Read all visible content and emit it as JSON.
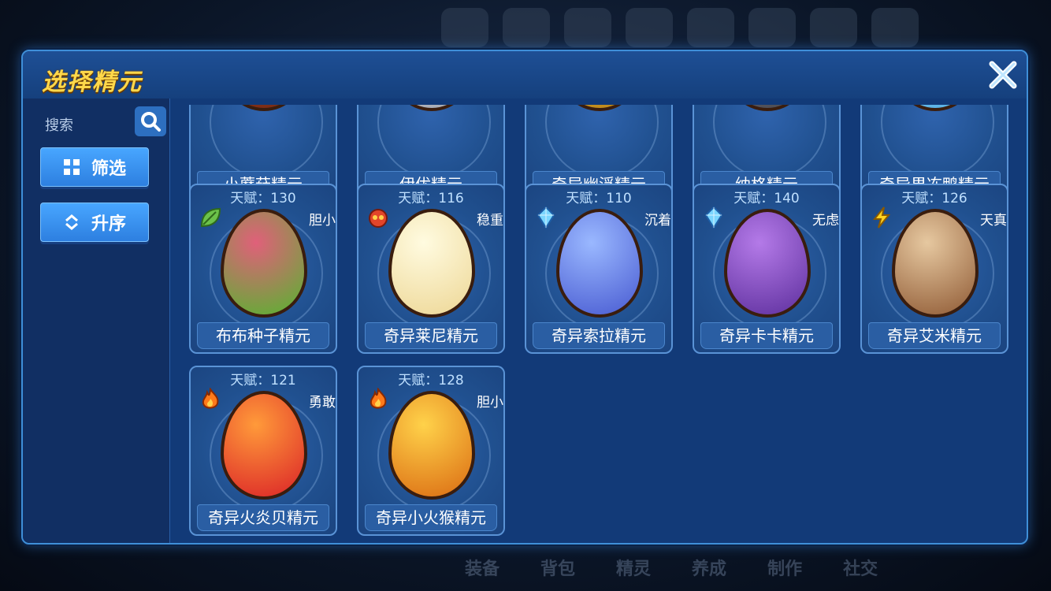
{
  "modal": {
    "title": "选择精元"
  },
  "sidebar": {
    "search_label": "搜索",
    "filter_label": "筛选",
    "sort_label": "升序"
  },
  "background": {
    "bottom_nav": [
      "装备",
      "背包",
      "精灵",
      "养成",
      "制作",
      "社交"
    ]
  },
  "cards": [
    {
      "name": "小蘑菇精元",
      "partial": true,
      "color_a": "#c2532a",
      "color_b": "#7a2c16"
    },
    {
      "name": "伊优精元",
      "partial": true,
      "color_a": "#e8eaee",
      "color_b": "#a8acb6"
    },
    {
      "name": "奇异幽浮精元",
      "partial": true,
      "color_a": "#f2c44a",
      "color_b": "#c08a1c"
    },
    {
      "name": "纳格精元",
      "partial": true,
      "color_a": "#8a8a90",
      "color_b": "#4e4e56"
    },
    {
      "name": "奇异果冻鸭精元",
      "partial": true,
      "color_a": "#a8e4ff",
      "color_b": "#5bb2e6"
    },
    {
      "name": "布布种子精元",
      "talent": "天赋：130",
      "nature": "胆小",
      "type_icon": "leaf-icon",
      "color_a": "#e0607a",
      "color_b": "#6aa83a"
    },
    {
      "name": "奇异莱尼精元",
      "talent": "天赋：116",
      "nature": "稳重",
      "type_icon": "fire-spirit-icon",
      "color_a": "#fffbe0",
      "color_b": "#f0dca0"
    },
    {
      "name": "奇异索拉精元",
      "talent": "天赋：110",
      "nature": "沉着",
      "type_icon": "crystal-icon",
      "color_a": "#9ab8ff",
      "color_b": "#5468d8"
    },
    {
      "name": "奇异卡卡精元",
      "talent": "天赋：140",
      "nature": "无虑",
      "type_icon": "crystal-icon",
      "color_a": "#b47ae8",
      "color_b": "#6a3aa8"
    },
    {
      "name": "奇异艾米精元",
      "talent": "天赋：126",
      "nature": "天真",
      "type_icon": "lightning-icon",
      "color_a": "#e6c8a0",
      "color_b": "#9c6a44"
    },
    {
      "name": "奇异火炎贝精元",
      "talent": "天赋：121",
      "nature": "勇敢",
      "type_icon": "fire-icon",
      "color_a": "#ff9a3a",
      "color_b": "#e0342a"
    },
    {
      "name": "奇异小火猴精元",
      "talent": "天赋：128",
      "nature": "胆小",
      "type_icon": "fire-icon",
      "color_a": "#ffd24a",
      "color_b": "#e07a1a"
    }
  ]
}
